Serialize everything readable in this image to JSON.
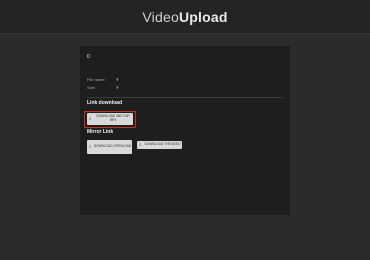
{
  "header": {
    "logo_light": "Video",
    "logo_bold": "Upload"
  },
  "file": {
    "title": "0",
    "name_label": "File name:",
    "name_value": "?",
    "size_label": "Size:",
    "size_value": "?"
  },
  "link_download": {
    "title": "Link download",
    "button_label": "DOWNLOAD 360/720P MP4"
  },
  "mirror_link": {
    "title": "Mirror Link",
    "buttons": [
      {
        "label": "DOWNLOAD OPENLOAD"
      },
      {
        "label": "DOWNLOAD THEVIDEO"
      }
    ]
  },
  "colors": {
    "highlight": "#c0302a",
    "panel": "#1e1e1e",
    "background": "#2b2b2b"
  }
}
